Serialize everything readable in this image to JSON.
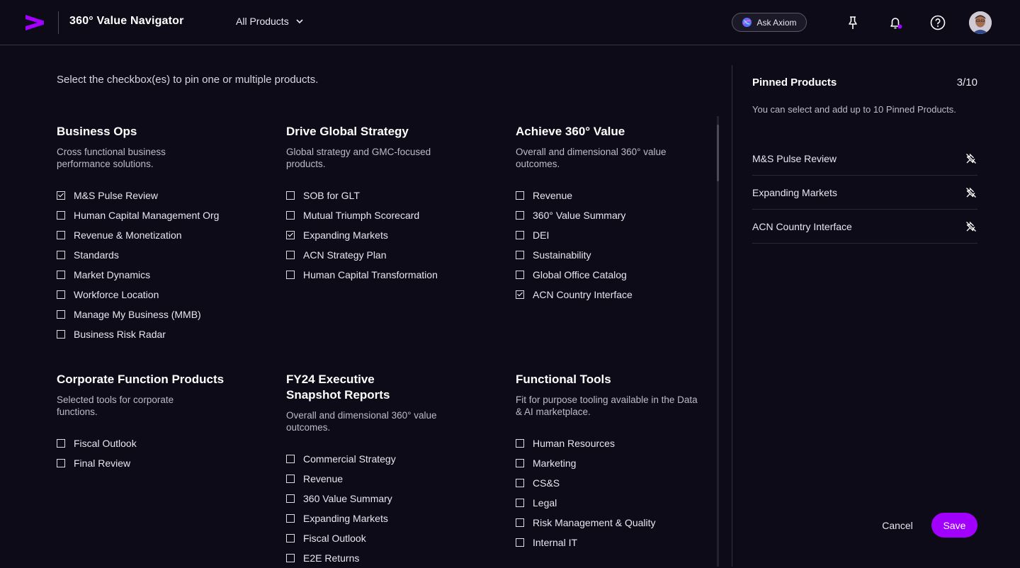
{
  "header": {
    "app_title": "360° Value Navigator",
    "products_dropdown": "All Products",
    "ask_button": "Ask Axiom",
    "brand_color": "#a100ff"
  },
  "main": {
    "instruction": "Select the checkbox(es) to pin one or multiple products.",
    "groups": [
      {
        "title": "Business Ops",
        "description": "Cross functional business performance solutions.",
        "items": [
          {
            "label": "M&S Pulse Review",
            "checked": true
          },
          {
            "label": "Human Capital Management Org",
            "checked": false
          },
          {
            "label": "Revenue & Monetization",
            "checked": false
          },
          {
            "label": "Standards",
            "checked": false
          },
          {
            "label": "Market Dynamics",
            "checked": false
          },
          {
            "label": "Workforce Location",
            "checked": false
          },
          {
            "label": "Manage My Business (MMB)",
            "checked": false
          },
          {
            "label": "Business Risk Radar",
            "checked": false
          }
        ]
      },
      {
        "title": "Drive Global Strategy",
        "description": "Global strategy and GMC-focused products.",
        "items": [
          {
            "label": "SOB for GLT",
            "checked": false
          },
          {
            "label": "Mutual Triumph Scorecard",
            "checked": false
          },
          {
            "label": "Expanding Markets",
            "checked": true
          },
          {
            "label": "ACN Strategy Plan",
            "checked": false
          },
          {
            "label": "Human Capital Transformation",
            "checked": false
          }
        ]
      },
      {
        "title": "Achieve 360° Value",
        "description": "Overall and dimensional 360° value outcomes.",
        "items": [
          {
            "label": "Revenue",
            "checked": false
          },
          {
            "label": "360° Value Summary",
            "checked": false
          },
          {
            "label": "DEI",
            "checked": false
          },
          {
            "label": "Sustainability",
            "checked": false
          },
          {
            "label": "Global Office Catalog",
            "checked": false
          },
          {
            "label": "ACN Country Interface",
            "checked": true
          }
        ]
      },
      {
        "title": "Corporate Function Products",
        "description": "Selected tools for corporate functions.",
        "items": [
          {
            "label": "Fiscal Outlook",
            "checked": false
          },
          {
            "label": "Final Review",
            "checked": false
          }
        ]
      },
      {
        "title": "FY24 Executive Snapshot Reports",
        "description": "Overall and dimensional 360° value outcomes.",
        "items": [
          {
            "label": "Commercial Strategy",
            "checked": false
          },
          {
            "label": "Revenue",
            "checked": false
          },
          {
            "label": "360 Value Summary",
            "checked": false
          },
          {
            "label": "Expanding Markets",
            "checked": false
          },
          {
            "label": "Fiscal Outlook",
            "checked": false
          },
          {
            "label": "E2E Returns",
            "checked": false
          }
        ]
      },
      {
        "title": "Functional Tools",
        "description": "Fit for purpose tooling available in the Data & AI marketplace.",
        "items": [
          {
            "label": "Human Resources",
            "checked": false
          },
          {
            "label": "Marketing",
            "checked": false
          },
          {
            "label": "CS&S",
            "checked": false
          },
          {
            "label": "Legal",
            "checked": false
          },
          {
            "label": "Risk Management & Quality",
            "checked": false
          },
          {
            "label": "Internal IT",
            "checked": false
          }
        ]
      }
    ]
  },
  "side_panel": {
    "title": "Pinned Products",
    "count": "3/10",
    "description": "You can select and add up to 10 Pinned Products.",
    "items": [
      "M&S Pulse Review",
      "Expanding Markets",
      "ACN Country Interface"
    ],
    "cancel_label": "Cancel",
    "save_label": "Save"
  }
}
